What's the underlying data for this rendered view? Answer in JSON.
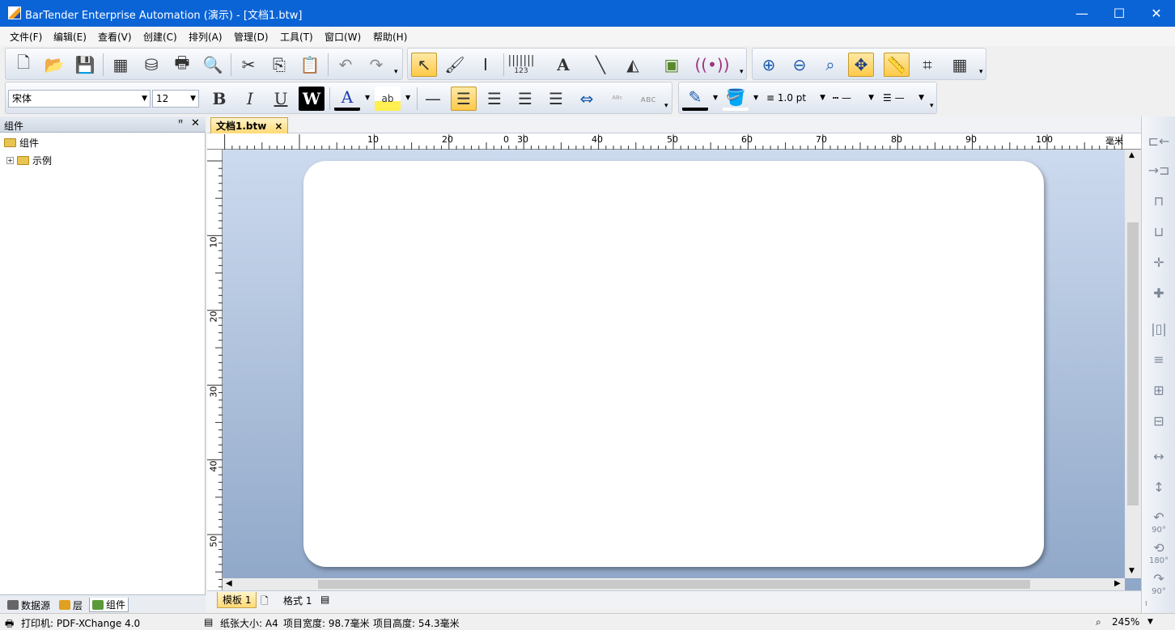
{
  "window": {
    "title": "BarTender Enterprise Automation (演示) - [文档1.btw]",
    "min": "—",
    "max": "☐",
    "close": "✕"
  },
  "menu": [
    "文件(F)",
    "编辑(E)",
    "查看(V)",
    "创建(C)",
    "排列(A)",
    "管理(D)",
    "工具(T)",
    "窗口(W)",
    "帮助(H)"
  ],
  "toolbar1": {
    "barcode_caption": "123"
  },
  "toolbar2": {
    "font_name": "宋体",
    "font_size": "12",
    "bold": "B",
    "italic": "I",
    "underline": "U",
    "reverse": "W",
    "font_color": "A",
    "highlight": "ab",
    "line_width": "1.0 pt"
  },
  "left_panel": {
    "title": "组件",
    "pin": "ꟸ",
    "close": "✕",
    "tree_root": "组件",
    "tree_child": "示例",
    "expander": "+",
    "tabs": [
      "数据源",
      "层",
      "组件"
    ]
  },
  "document": {
    "tab_label": "文档1.btw",
    "tab_close": "×",
    "ruler_unit": "毫米",
    "h_ruler_labels": [
      "0",
      "10",
      "20",
      "30",
      "40",
      "50",
      "60",
      "70",
      "80",
      "90",
      "100"
    ],
    "v_ruler_labels": [
      "10",
      "20",
      "30",
      "40",
      "50"
    ],
    "sheet_tabs": [
      "模板 1",
      "格式 1"
    ]
  },
  "right_toolbar": {
    "rotate_90_ccw": "90°",
    "rotate_180": "180°",
    "rotate_90_cw": "90°"
  },
  "status": {
    "printer": "打印机: PDF-XChange 4.0",
    "paper": "纸张大小: A4",
    "item_width": "项目宽度: 98.7毫米",
    "item_height": "项目高度: 54.3毫米",
    "zoom": "245%"
  },
  "colors": {
    "titlebar": "#0a64d6",
    "active_tab": "#ffd976",
    "canvas_top": "#cfdcf0",
    "canvas_bottom": "#8fa7c8"
  }
}
